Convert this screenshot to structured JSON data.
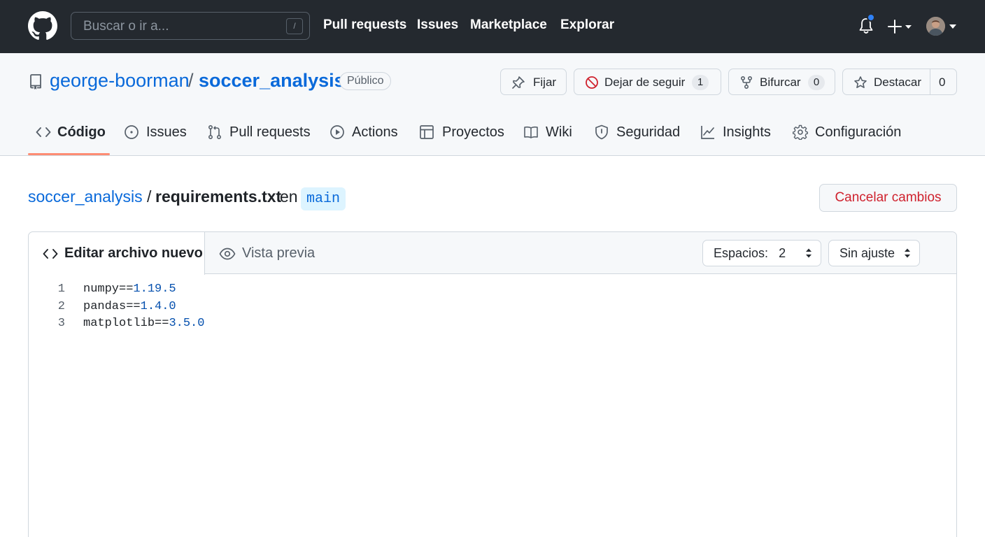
{
  "header": {
    "search_placeholder": "Buscar o ir a...",
    "search_shortcut": "/",
    "nav": [
      "Pull requests",
      "Issues",
      "Marketplace",
      "Explorar"
    ],
    "icons": [
      "github-logo-icon",
      "bell-icon",
      "plus-icon",
      "avatar"
    ]
  },
  "repo": {
    "owner": "george-boorman",
    "separator": "/",
    "name": "soccer_analysis",
    "visibility": "Público",
    "actions": {
      "pin": {
        "label": "Fijar"
      },
      "unwatch": {
        "label": "Dejar de seguir",
        "count": "1"
      },
      "fork": {
        "label": "Bifurcar",
        "count": "0"
      },
      "star": {
        "label": "Destacar",
        "count": "0"
      }
    },
    "tabs": [
      {
        "label": "Código",
        "icon": "code-icon",
        "active": true
      },
      {
        "label": "Issues",
        "icon": "issue-icon"
      },
      {
        "label": "Pull requests",
        "icon": "pull-request-icon"
      },
      {
        "label": "Actions",
        "icon": "play-icon"
      },
      {
        "label": "Proyectos",
        "icon": "table-icon"
      },
      {
        "label": "Wiki",
        "icon": "book-icon"
      },
      {
        "label": "Seguridad",
        "icon": "shield-icon"
      },
      {
        "label": "Insights",
        "icon": "graph-icon"
      },
      {
        "label": "Configuración",
        "icon": "gear-icon"
      }
    ]
  },
  "editor": {
    "path_repo": "soccer_analysis",
    "path_sep": "/",
    "filename": "requirements.txt",
    "in_word": "en",
    "branch": "main",
    "cancel_label": "Cancelar cambios",
    "tab_edit": "Editar archivo nuevo",
    "tab_preview": "Vista previa",
    "indent_label": "Espacios:",
    "indent_value": "2",
    "wrap_label": "Sin ajuste",
    "lines": [
      {
        "no": "1",
        "name": "numpy",
        "op": "==",
        "version": "1.19.5"
      },
      {
        "no": "2",
        "name": "pandas",
        "op": "==",
        "version": "1.4.0"
      },
      {
        "no": "3",
        "name": "matplotlib",
        "op": "==",
        "version": "3.5.0"
      }
    ]
  },
  "colors": {
    "header_bg": "#24292f",
    "link": "#0969da",
    "danger": "#cf222e",
    "tab_underline": "#fd8c73",
    "notification_dot": "#2f81f7"
  }
}
